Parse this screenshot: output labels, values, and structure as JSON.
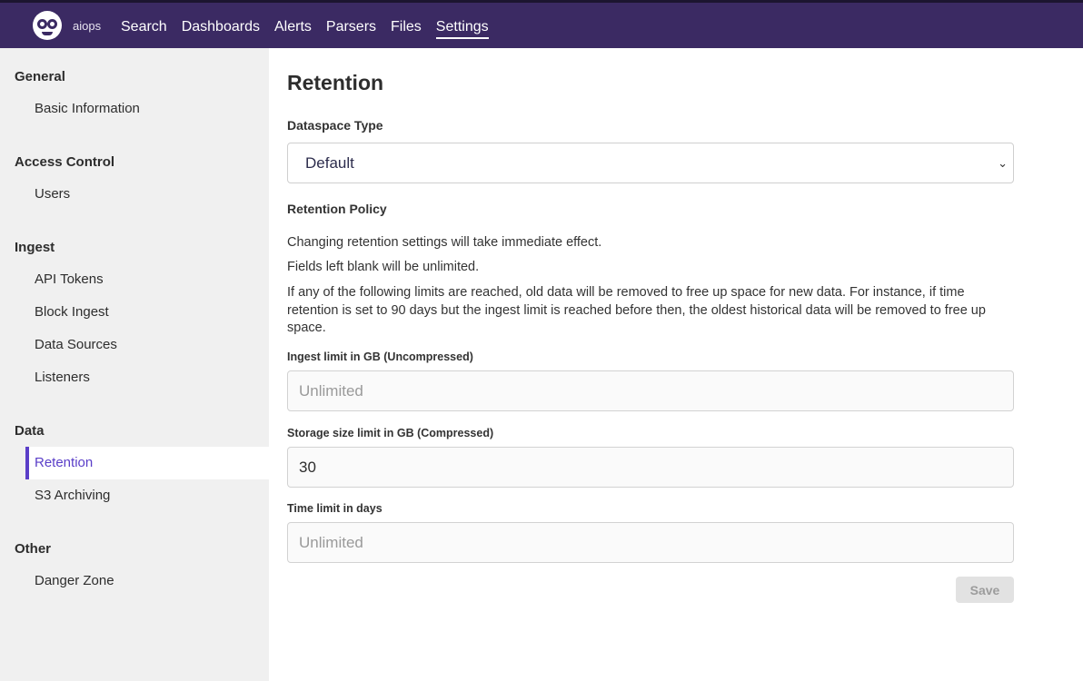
{
  "header": {
    "org_name": "aiops",
    "logo_icon": "owl-logo-icon",
    "nav": [
      "Search",
      "Dashboards",
      "Alerts",
      "Parsers",
      "Files",
      "Settings"
    ],
    "active_nav": "Settings"
  },
  "sidebar": {
    "sections": [
      {
        "title": "General",
        "items": [
          "Basic Information"
        ]
      },
      {
        "title": "Access Control",
        "items": [
          "Users"
        ]
      },
      {
        "title": "Ingest",
        "items": [
          "API Tokens",
          "Block Ingest",
          "Data Sources",
          "Listeners"
        ]
      },
      {
        "title": "Data",
        "items": [
          "Retention",
          "S3 Archiving"
        ]
      },
      {
        "title": "Other",
        "items": [
          "Danger Zone"
        ]
      }
    ],
    "active_item": "Retention",
    "accent_color": "#5a3ec8"
  },
  "main": {
    "title": "Retention",
    "dataspace_type_label": "Dataspace Type",
    "dataspace_type_value": "Default",
    "policy_label": "Retention Policy",
    "info_1": "Changing retention settings will take immediate effect.",
    "info_2": "Fields left blank will be unlimited.",
    "info_3": "If any of the following limits are reached, old data will be removed to free up space for new data. For instance, if time retention is set to 90 days but the ingest limit is reached before then, the oldest historical data will be removed to free up space.",
    "ingest_label": "Ingest limit in GB (Uncompressed)",
    "ingest_placeholder": "Unlimited",
    "ingest_value": "",
    "storage_label": "Storage size limit in GB (Compressed)",
    "storage_placeholder": "Unlimited",
    "storage_value": "30",
    "time_label": "Time limit in days",
    "time_placeholder": "Unlimited",
    "time_value": "",
    "save_label": "Save"
  },
  "colors": {
    "topbar": "#3b2a63",
    "sidebar_bg": "#f0f0f0"
  }
}
